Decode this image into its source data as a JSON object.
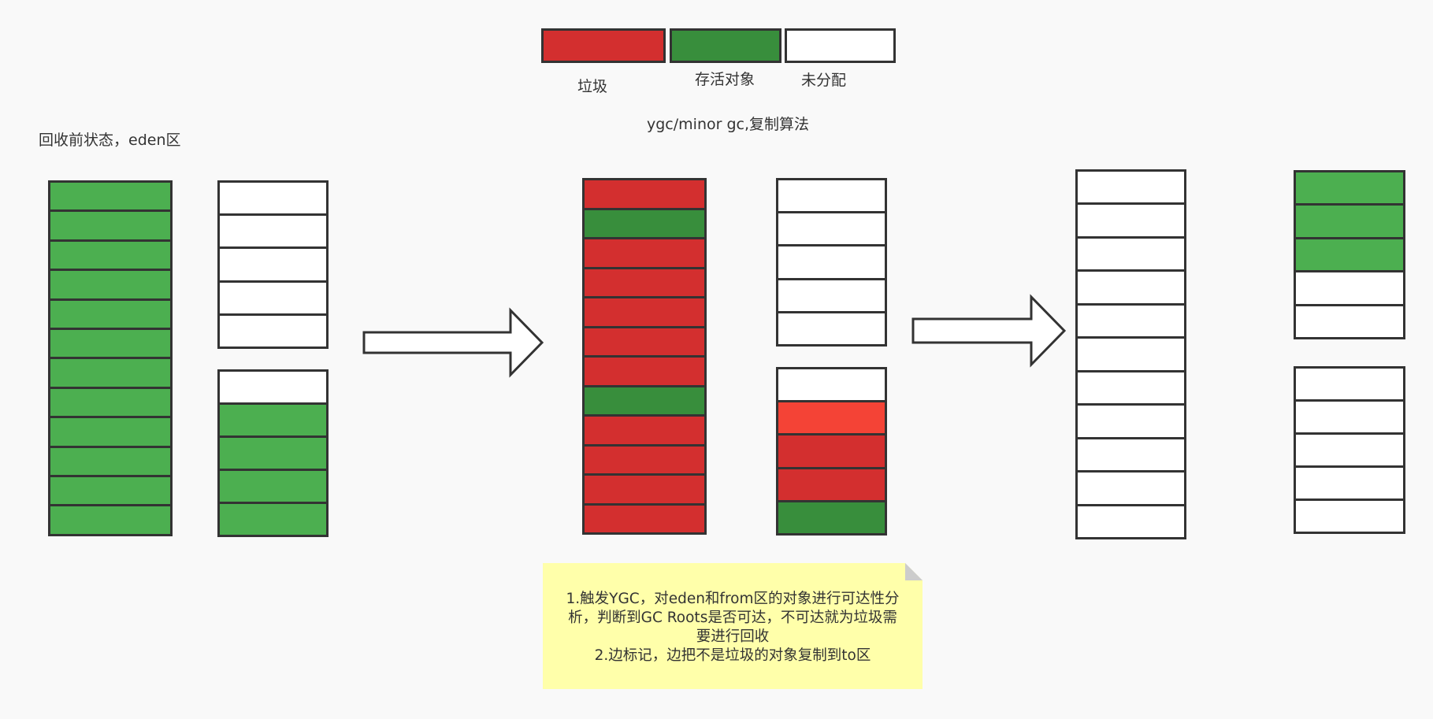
{
  "colors": {
    "garbage": "#d32f2f",
    "garbage_bright": "#f44336",
    "alive": "#4caf50",
    "alive_dark": "#388e3c",
    "unallocated": "#ffffff",
    "note_bg": "#ffffaa",
    "border": "#333333"
  },
  "legend": {
    "items": [
      {
        "key": "garbage",
        "label": "垃圾",
        "color": "#d32f2f"
      },
      {
        "key": "alive",
        "label": "存活对象",
        "color": "#388e3c"
      },
      {
        "key": "unallocated",
        "label": "未分配",
        "color": "#ffffff"
      }
    ]
  },
  "title": "ygc/minor gc,复制算法",
  "before_state_label": "回收前状态，eden区",
  "stages": {
    "stage1": {
      "eden": [
        "#4caf50",
        "#4caf50",
        "#4caf50",
        "#4caf50",
        "#4caf50",
        "#4caf50",
        "#4caf50",
        "#4caf50",
        "#4caf50",
        "#4caf50",
        "#4caf50",
        "#4caf50"
      ],
      "survivor_a": [
        "#ffffff",
        "#ffffff",
        "#ffffff",
        "#ffffff",
        "#ffffff"
      ],
      "survivor_b": [
        "#ffffff",
        "#4caf50",
        "#4caf50",
        "#4caf50",
        "#4caf50"
      ]
    },
    "stage2": {
      "eden": [
        "#d32f2f",
        "#388e3c",
        "#d32f2f",
        "#d32f2f",
        "#d32f2f",
        "#d32f2f",
        "#d32f2f",
        "#388e3c",
        "#d32f2f",
        "#d32f2f",
        "#d32f2f",
        "#d32f2f"
      ],
      "survivor_a": [
        "#ffffff",
        "#ffffff",
        "#ffffff",
        "#ffffff",
        "#ffffff"
      ],
      "survivor_b": [
        "#ffffff",
        "#f44336",
        "#d32f2f",
        "#d32f2f",
        "#388e3c"
      ]
    },
    "stage3": {
      "eden": [
        "#ffffff",
        "#ffffff",
        "#ffffff",
        "#ffffff",
        "#ffffff",
        "#ffffff",
        "#ffffff",
        "#ffffff",
        "#ffffff",
        "#ffffff",
        "#ffffff"
      ],
      "survivor_a": [
        "#4caf50",
        "#4caf50",
        "#4caf50",
        "#ffffff",
        "#ffffff"
      ],
      "survivor_b": [
        "#ffffff",
        "#ffffff",
        "#ffffff",
        "#ffffff",
        "#ffffff"
      ]
    }
  },
  "note": {
    "lines": [
      "1.触发YGC，对eden和from区的对象进行可达性分",
      "析，判断到GC Roots是否可达，不可达就为垃圾需",
      "要进行回收",
      "2.边标记，边把不是垃圾的对象复制到to区"
    ]
  }
}
